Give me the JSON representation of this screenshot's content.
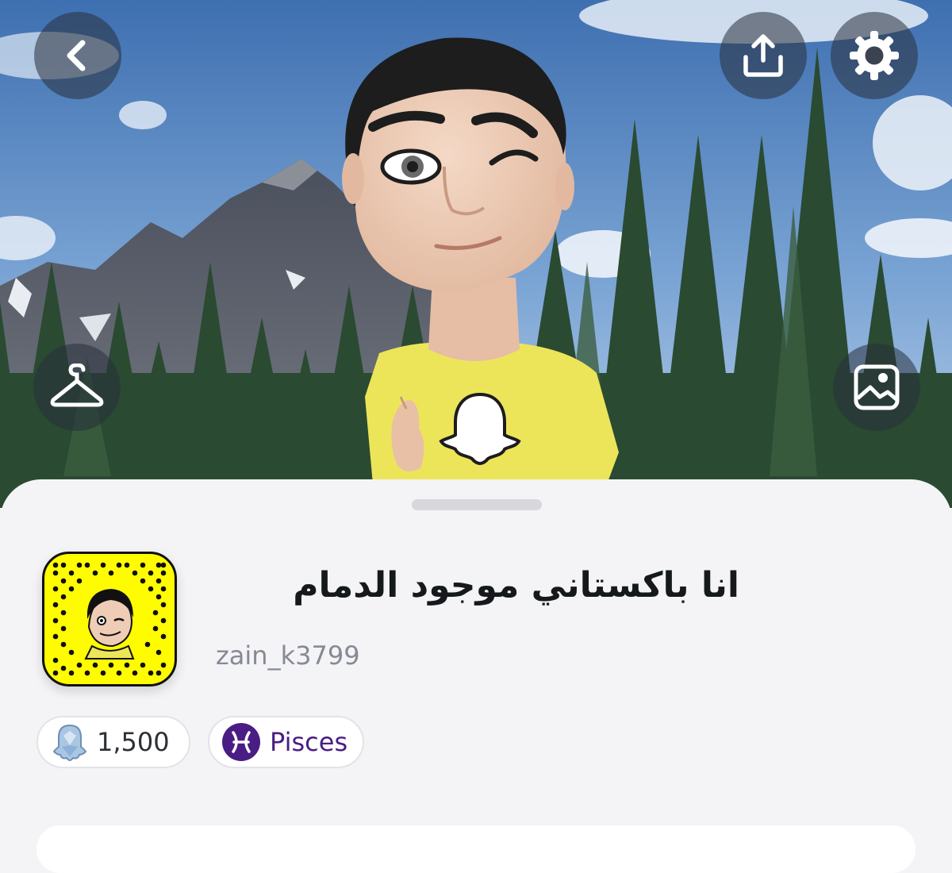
{
  "profile": {
    "display_name": "انا باكستاني موجود الدمام",
    "username": "zain_k3799",
    "snapscore": "1,500",
    "zodiac": "Pisces"
  },
  "icons": {
    "back": "chevron-left-icon",
    "share": "upload-icon",
    "settings": "gear-icon",
    "outfit": "hanger-icon",
    "background": "image-icon",
    "score": "ghost-crystal-icon",
    "zodiac": "pisces-icon"
  },
  "colors": {
    "snap_yellow": "#fffc00",
    "zodiac_purple": "#4a1d84",
    "sheet_bg": "#f4f4f6",
    "username_gray": "#858a93"
  }
}
